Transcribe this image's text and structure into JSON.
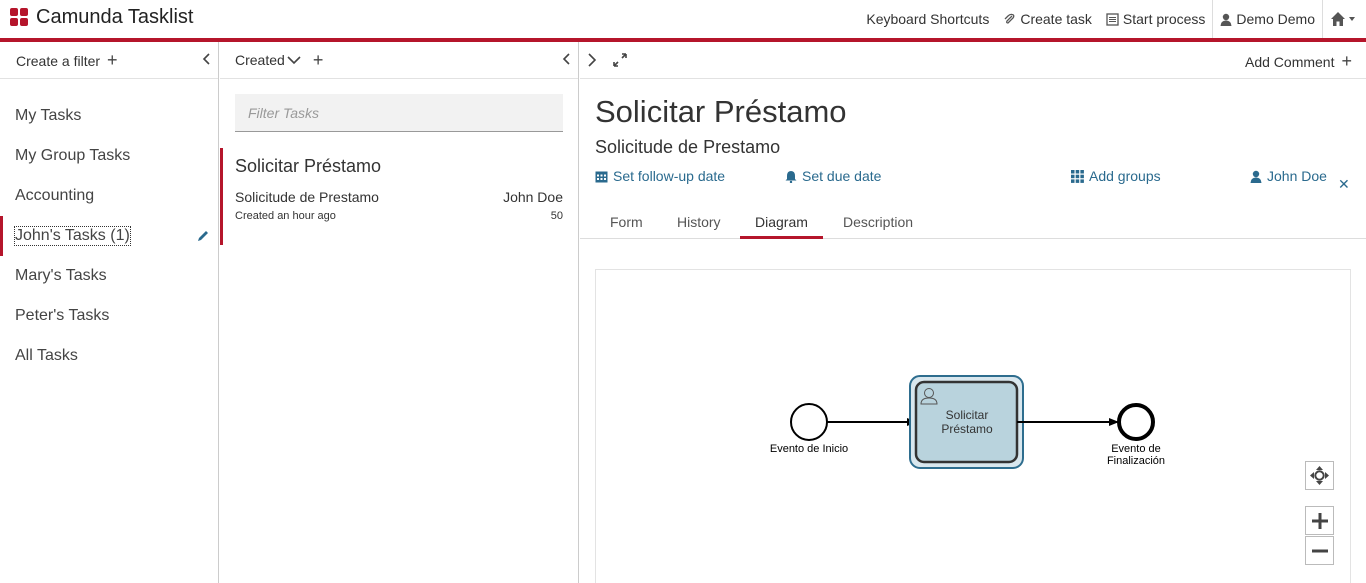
{
  "header": {
    "app_title": "Camunda Tasklist",
    "nav": {
      "keyboard_shortcuts": "Keyboard Shortcuts",
      "create_task": "Create task",
      "start_process": "Start process",
      "user": "Demo Demo"
    }
  },
  "filters": {
    "create_label": "Create a filter",
    "items": [
      {
        "label": "My Tasks"
      },
      {
        "label": "My Group Tasks"
      },
      {
        "label": "Accounting"
      },
      {
        "label": "John's Tasks",
        "count": "(1)"
      },
      {
        "label": "Mary's Tasks"
      },
      {
        "label": "Peter's Tasks"
      },
      {
        "label": "All Tasks"
      }
    ]
  },
  "list": {
    "sort_label": "Created",
    "search_placeholder": "Filter Tasks",
    "tasks": [
      {
        "name": "Solicitar Préstamo",
        "process": "Solicitude de Prestamo",
        "assignee": "John Doe",
        "created": "Created an hour ago",
        "priority": "50"
      }
    ]
  },
  "detail": {
    "add_comment": "Add Comment",
    "title": "Solicitar Préstamo",
    "process_name": "Solicitude de Prestamo",
    "actions": {
      "follow_up": "Set follow-up date",
      "due_date": "Set due date",
      "groups": "Add groups",
      "assignee": "John Doe"
    },
    "tabs": [
      "Form",
      "History",
      "Diagram",
      "Description"
    ],
    "active_tab": "Diagram",
    "diagram": {
      "start_event": "Evento de Inicio",
      "task_line1": "Solicitar",
      "task_line2": "Préstamo",
      "end_line1": "Evento de",
      "end_line2": "Finalización"
    }
  },
  "colors": {
    "brand": "#b5152b",
    "link": "#2a6a8e",
    "task_fill": "#b9d3dd",
    "task_highlight": "#2e6d8e"
  }
}
